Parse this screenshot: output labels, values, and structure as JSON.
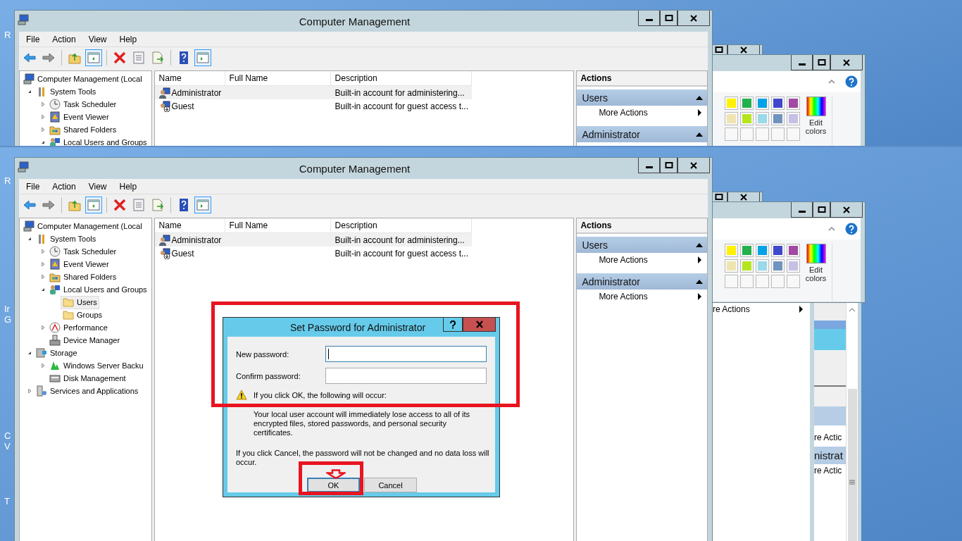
{
  "screens": [
    {
      "desktop_labels": [
        "R"
      ],
      "window": {
        "title": "Computer Management",
        "menu": [
          "File",
          "Action",
          "View",
          "Help"
        ],
        "toolbar": [
          {
            "kind": "back",
            "pressed": false
          },
          {
            "kind": "forward",
            "pressed": false
          },
          {
            "kind": "separator"
          },
          {
            "kind": "up",
            "pressed": false
          },
          {
            "kind": "console-tree",
            "pressed": true
          },
          {
            "kind": "separator"
          },
          {
            "kind": "delete",
            "pressed": false
          },
          {
            "kind": "properties",
            "pressed": false
          },
          {
            "kind": "export",
            "pressed": false
          },
          {
            "kind": "separator"
          },
          {
            "kind": "help",
            "pressed": false
          },
          {
            "kind": "action-pane",
            "pressed": true
          }
        ],
        "tree": [
          {
            "label": "Computer Management (Local",
            "kind": "computer",
            "selected": false,
            "children": [
              {
                "label": "System Tools",
                "kind": "tools",
                "expanded": true,
                "selected": false,
                "children": [
                  {
                    "label": "Task Scheduler",
                    "kind": "clock",
                    "expanded": false,
                    "selected": false
                  },
                  {
                    "label": "Event Viewer",
                    "kind": "event",
                    "expanded": false,
                    "selected": false
                  },
                  {
                    "label": "Shared Folders",
                    "kind": "share",
                    "expanded": false,
                    "selected": false
                  },
                  {
                    "label": "Local Users and Groups",
                    "kind": "users",
                    "expanded": true,
                    "selected": false
                  }
                ]
              }
            ]
          }
        ],
        "columns": [
          "Name",
          "Full Name",
          "Description"
        ],
        "rows": [
          {
            "kind": "user",
            "name": "Administrator",
            "description": "Built-in account for administering...",
            "selected": true
          },
          {
            "kind": "user-down",
            "name": "Guest",
            "description": "Built-in account for guest access t...",
            "selected": false
          }
        ],
        "actions": {
          "header": "Actions",
          "groups": [
            {
              "title": "Users",
              "items": [
                "More Actions"
              ]
            },
            {
              "title": "Administrator"
            }
          ]
        }
      },
      "paint": {
        "swatches": [
          {
            "kind": "color",
            "color": "#fff200"
          },
          {
            "kind": "color",
            "color": "#22b14c"
          },
          {
            "kind": "color",
            "color": "#00a2e8"
          },
          {
            "kind": "color",
            "color": "#3f48cc"
          },
          {
            "kind": "color",
            "color": "#a349a4"
          },
          {
            "kind": "color",
            "color": "#efe4b0"
          },
          {
            "kind": "color",
            "color": "#b5e61d"
          },
          {
            "kind": "color",
            "color": "#99d9ea"
          },
          {
            "kind": "color",
            "color": "#7092be"
          },
          {
            "kind": "color",
            "color": "#c8bfe7"
          },
          {
            "kind": "empty"
          },
          {
            "kind": "empty"
          },
          {
            "kind": "empty"
          },
          {
            "kind": "empty"
          },
          {
            "kind": "empty"
          }
        ],
        "edit_colors": "Edit colors"
      }
    },
    {
      "desktop_labels": [
        "R",
        "Ir",
        "G",
        "C",
        "V",
        "T"
      ],
      "window": {
        "title": "Computer Management",
        "menu": [
          "File",
          "Action",
          "View",
          "Help"
        ],
        "toolbar": [
          {
            "kind": "back",
            "pressed": false
          },
          {
            "kind": "forward",
            "pressed": false
          },
          {
            "kind": "separator"
          },
          {
            "kind": "up",
            "pressed": false
          },
          {
            "kind": "console-tree",
            "pressed": true
          },
          {
            "kind": "separator"
          },
          {
            "kind": "delete",
            "pressed": false
          },
          {
            "kind": "properties",
            "pressed": false
          },
          {
            "kind": "export",
            "pressed": false
          },
          {
            "kind": "separator"
          },
          {
            "kind": "help",
            "pressed": false
          },
          {
            "kind": "action-pane",
            "pressed": true
          }
        ],
        "tree": [
          {
            "label": "Computer Management (Local",
            "kind": "computer",
            "selected": false,
            "children": [
              {
                "label": "System Tools",
                "kind": "tools",
                "expanded": true,
                "selected": false,
                "children": [
                  {
                    "label": "Task Scheduler",
                    "kind": "clock",
                    "expanded": false,
                    "selected": false
                  },
                  {
                    "label": "Event Viewer",
                    "kind": "event",
                    "expanded": false,
                    "selected": false
                  },
                  {
                    "label": "Shared Folders",
                    "kind": "share",
                    "expanded": false,
                    "selected": false
                  },
                  {
                    "label": "Local Users and Groups",
                    "kind": "users",
                    "expanded": true,
                    "selected": false,
                    "children": [
                      {
                        "label": "Users",
                        "kind": "folder",
                        "selected": true
                      },
                      {
                        "label": "Groups",
                        "kind": "folder",
                        "selected": false
                      }
                    ]
                  },
                  {
                    "label": "Performance",
                    "kind": "performance",
                    "expanded": false,
                    "selected": false
                  },
                  {
                    "label": "Device Manager",
                    "kind": "device",
                    "selected": false
                  }
                ]
              },
              {
                "label": "Storage",
                "kind": "storage",
                "expanded": true,
                "selected": false,
                "children": [
                  {
                    "label": "Windows Server Backu",
                    "kind": "backup",
                    "expanded": false,
                    "selected": false
                  },
                  {
                    "label": "Disk Management",
                    "kind": "disk",
                    "selected": false
                  }
                ]
              },
              {
                "label": "Services and Applications",
                "kind": "services",
                "expanded": false,
                "selected": false
              }
            ]
          }
        ],
        "columns": [
          "Name",
          "Full Name",
          "Description"
        ],
        "rows": [
          {
            "kind": "user",
            "name": "Administrator",
            "description": "Built-in account for administering...",
            "selected": true
          },
          {
            "kind": "user-down",
            "name": "Guest",
            "description": "Built-in account for guest access t...",
            "selected": false
          }
        ],
        "actions": {
          "header": "Actions",
          "groups": [
            {
              "title": "Users",
              "items": [
                "More Actions"
              ]
            },
            {
              "title": "Administrator",
              "items": [
                "More Actions"
              ]
            }
          ]
        }
      },
      "paint": {
        "swatches": [
          {
            "kind": "color",
            "color": "#fff200"
          },
          {
            "kind": "color",
            "color": "#22b14c"
          },
          {
            "kind": "color",
            "color": "#00a2e8"
          },
          {
            "kind": "color",
            "color": "#3f48cc"
          },
          {
            "kind": "color",
            "color": "#a349a4"
          },
          {
            "kind": "color",
            "color": "#efe4b0"
          },
          {
            "kind": "color",
            "color": "#b5e61d"
          },
          {
            "kind": "color",
            "color": "#99d9ea"
          },
          {
            "kind": "color",
            "color": "#7092be"
          },
          {
            "kind": "color",
            "color": "#c8bfe7"
          },
          {
            "kind": "empty"
          },
          {
            "kind": "empty"
          },
          {
            "kind": "empty"
          },
          {
            "kind": "empty"
          },
          {
            "kind": "empty"
          }
        ],
        "edit_colors": "Edit colors"
      },
      "behind": {
        "menu_item": "re Actions",
        "fragments": [
          "re Actic",
          "nistrat",
          "re Actic"
        ]
      },
      "dialog": {
        "title": "Set Password for Administrator",
        "fields": [
          {
            "label": "New password:",
            "focused": true
          },
          {
            "label": "Confirm password:",
            "focused": false
          }
        ],
        "warning": "If you click OK, the following will occur:",
        "warning_detail": "Your local user account will immediately lose access to all of its encrypted files, stored passwords, and personal security certificates.",
        "cancel_note": "If you click Cancel, the password will not be changed and no data loss will occur.",
        "buttons": [
          {
            "label": "OK",
            "default": true
          },
          {
            "label": "Cancel",
            "default": false
          }
        ]
      }
    }
  ]
}
